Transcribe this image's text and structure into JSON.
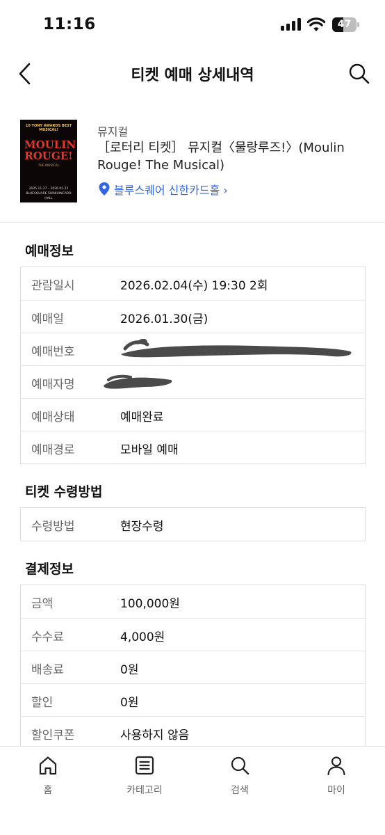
{
  "status_bar": {
    "time": "11:16",
    "battery": "47",
    "battery_level": 0.47
  },
  "header": {
    "title": "티켓 예매 상세내역",
    "back_icon": "chevron-left-icon",
    "search_icon": "search-icon"
  },
  "product": {
    "genre": "뮤지컬",
    "title": "［로터리 티켓］ 뮤지컬〈물랑루즈!〉(Moulin Rouge! The Musical)",
    "venue": "블루스퀘어 신한카드홀 ›",
    "venue_icon": "location-pin-icon",
    "poster": {
      "top_text": "10 TONY AWARDS BEST MUSICAL!",
      "logo": "MOULIN ROUGE!",
      "sub_text": "THE MUSICAL",
      "bottom_text": "2025.11.27 – 2026.02.22 BLUESQUARE SHINHANCARD HALL"
    }
  },
  "booking_info": {
    "title": "예매정보",
    "rows": [
      {
        "label": "관람일시",
        "value": "2026.02.04(수) 19:30 2회"
      },
      {
        "label": "예매일",
        "value": "2026.01.30(금)"
      },
      {
        "label": "예매번호",
        "value": ""
      },
      {
        "label": "예매자명",
        "value": ""
      },
      {
        "label": "예매상태",
        "value": "예매완료"
      },
      {
        "label": "예매경로",
        "value": "모바일 예매"
      }
    ]
  },
  "pickup": {
    "title": "티켓 수령방법",
    "rows": [
      {
        "label": "수령방법",
        "value": "현장수령"
      }
    ]
  },
  "payment": {
    "title": "결제정보",
    "rows": [
      {
        "label": "금액",
        "value": "100,000원"
      },
      {
        "label": "수수료",
        "value": "4,000원"
      },
      {
        "label": "배송료",
        "value": "0원"
      },
      {
        "label": "할인",
        "value": "0원"
      },
      {
        "label": "할인쿠폰",
        "value": "사용하지 않음"
      }
    ]
  },
  "bottom_nav": [
    {
      "label": "홈",
      "icon": "home-icon"
    },
    {
      "label": "카테고리",
      "icon": "category-list-icon"
    },
    {
      "label": "검색",
      "icon": "search-icon"
    },
    {
      "label": "마이",
      "icon": "person-icon"
    }
  ],
  "colors": {
    "link": "#3265e8",
    "border": "#dedede",
    "label": "#666666",
    "redaction": "#4a4a4a"
  }
}
